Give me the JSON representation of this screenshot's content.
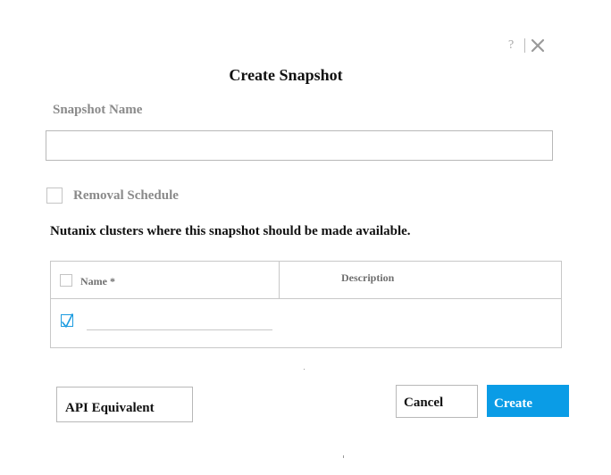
{
  "dialog": {
    "title": "Create Snapshot",
    "help_glyph": "?",
    "close_icon": "close-icon"
  },
  "snapshot_name": {
    "label": "Snapshot Name",
    "value": "",
    "placeholder": ""
  },
  "removal_schedule": {
    "label": "Removal Schedule",
    "checked": false
  },
  "clusters": {
    "heading": "Nutanix clusters where this snapshot should be made available.",
    "columns": {
      "name": "Name *",
      "description": "Description"
    },
    "rows": [
      {
        "checked": true,
        "name": "",
        "description": ""
      }
    ]
  },
  "buttons": {
    "api_equivalent": "API Equivalent",
    "cancel": "Cancel",
    "create": "Create"
  },
  "colors": {
    "accent": "#0a9ce6",
    "muted_label": "#8a8a8a",
    "border": "#c8c8c8"
  }
}
